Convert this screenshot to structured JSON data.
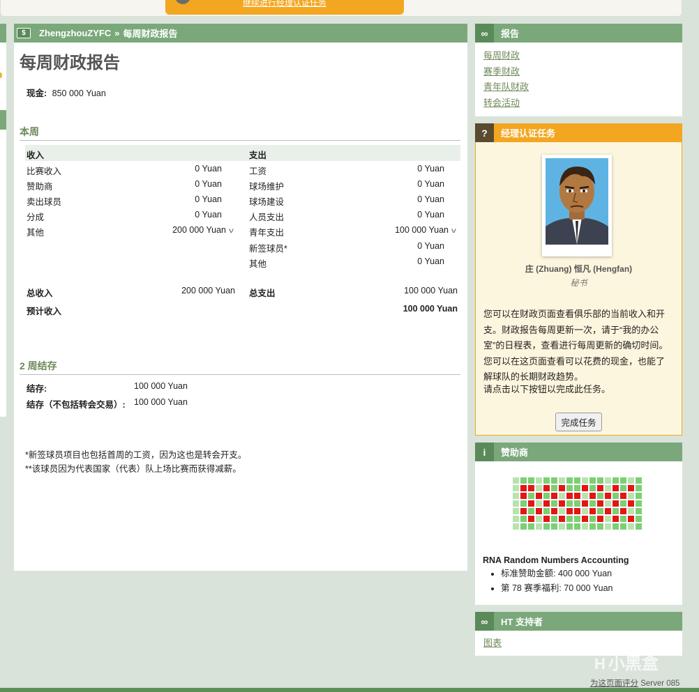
{
  "top": {
    "orange_button": "继续进行经理认证任务"
  },
  "breadcrumb": {
    "club": "ZhengzhouZYFC",
    "sep": "»",
    "page": "每周财政报告"
  },
  "title": "每周财政报告",
  "cash": {
    "label": "现金:",
    "value": "850 000 Yuan"
  },
  "this_week": {
    "title": "本周",
    "income_header": "收入",
    "expense_header": "支出",
    "income": [
      {
        "label": "比赛收入",
        "value": "0 Yuan"
      },
      {
        "label": "赞助商",
        "value": "0 Yuan"
      },
      {
        "label": "卖出球员",
        "value": "0 Yuan"
      },
      {
        "label": "分成",
        "value": "0 Yuan"
      },
      {
        "label": "其他",
        "value": "200 000 Yuan"
      }
    ],
    "expenses": [
      {
        "label": "工资",
        "value": "0 Yuan"
      },
      {
        "label": "球场维护",
        "value": "0 Yuan"
      },
      {
        "label": "球场建设",
        "value": "0 Yuan"
      },
      {
        "label": "人员支出",
        "value": "0 Yuan"
      },
      {
        "label": "青年支出",
        "value": "100 000 Yuan"
      },
      {
        "label": "新签球员*",
        "value": "0 Yuan"
      },
      {
        "label": "其他",
        "value": "0 Yuan"
      }
    ],
    "total_income_label": "总收入",
    "total_income": "200 000 Yuan",
    "total_expense_label": "总支出",
    "total_expense": "100 000 Yuan",
    "expected_label": "预计收入",
    "expected": "100 000 Yuan"
  },
  "balance": {
    "title": "2 周结存",
    "rows": [
      {
        "label": "结存:",
        "value": "100 000 Yuan"
      },
      {
        "label": "结存（不包括转会交易）:",
        "value": "100 000 Yuan"
      }
    ]
  },
  "notes": [
    "*新签球员项目也包括首周的工资，因为这也是转会开支。",
    "**该球员因为代表国家（代表）队上场比赛而获得减薪。"
  ],
  "reports": {
    "title": "报告",
    "links": [
      "每周财政",
      "赛季财政",
      "青年队财政",
      "转会活动"
    ]
  },
  "task": {
    "title": "经理认证任务",
    "person_name": "庄 (Zhuang) 恒凡 (Hengfan)",
    "person_role": "秘书",
    "text": "您可以在财政页面查看俱乐部的当前收入和开支。财政报告每周更新一次，请于“我的办公室”的日程表，查看进行每周更新的确切时间。您可以在这页面查看可以花费的现金，也能了解球队的长期财政趋势。",
    "prompt": "请点击以下按钮以完成此任务。",
    "button": "完成任务"
  },
  "sponsor": {
    "title": "赞助商",
    "name": "RNA Random Numbers Accounting",
    "items": [
      "标准赞助金额: 400 000 Yuan",
      "第 78 赛季福利: 70 000 Yuan"
    ]
  },
  "supporter": {
    "title": "HT 支持者",
    "link": "图表"
  },
  "footer": {
    "rate": "为这页面评分",
    "server": "Server 085"
  },
  "watermark": "小黑盒",
  "colors": {
    "green": "#7ba87a",
    "orange": "#f3a61f",
    "link": "#6f8a58"
  }
}
